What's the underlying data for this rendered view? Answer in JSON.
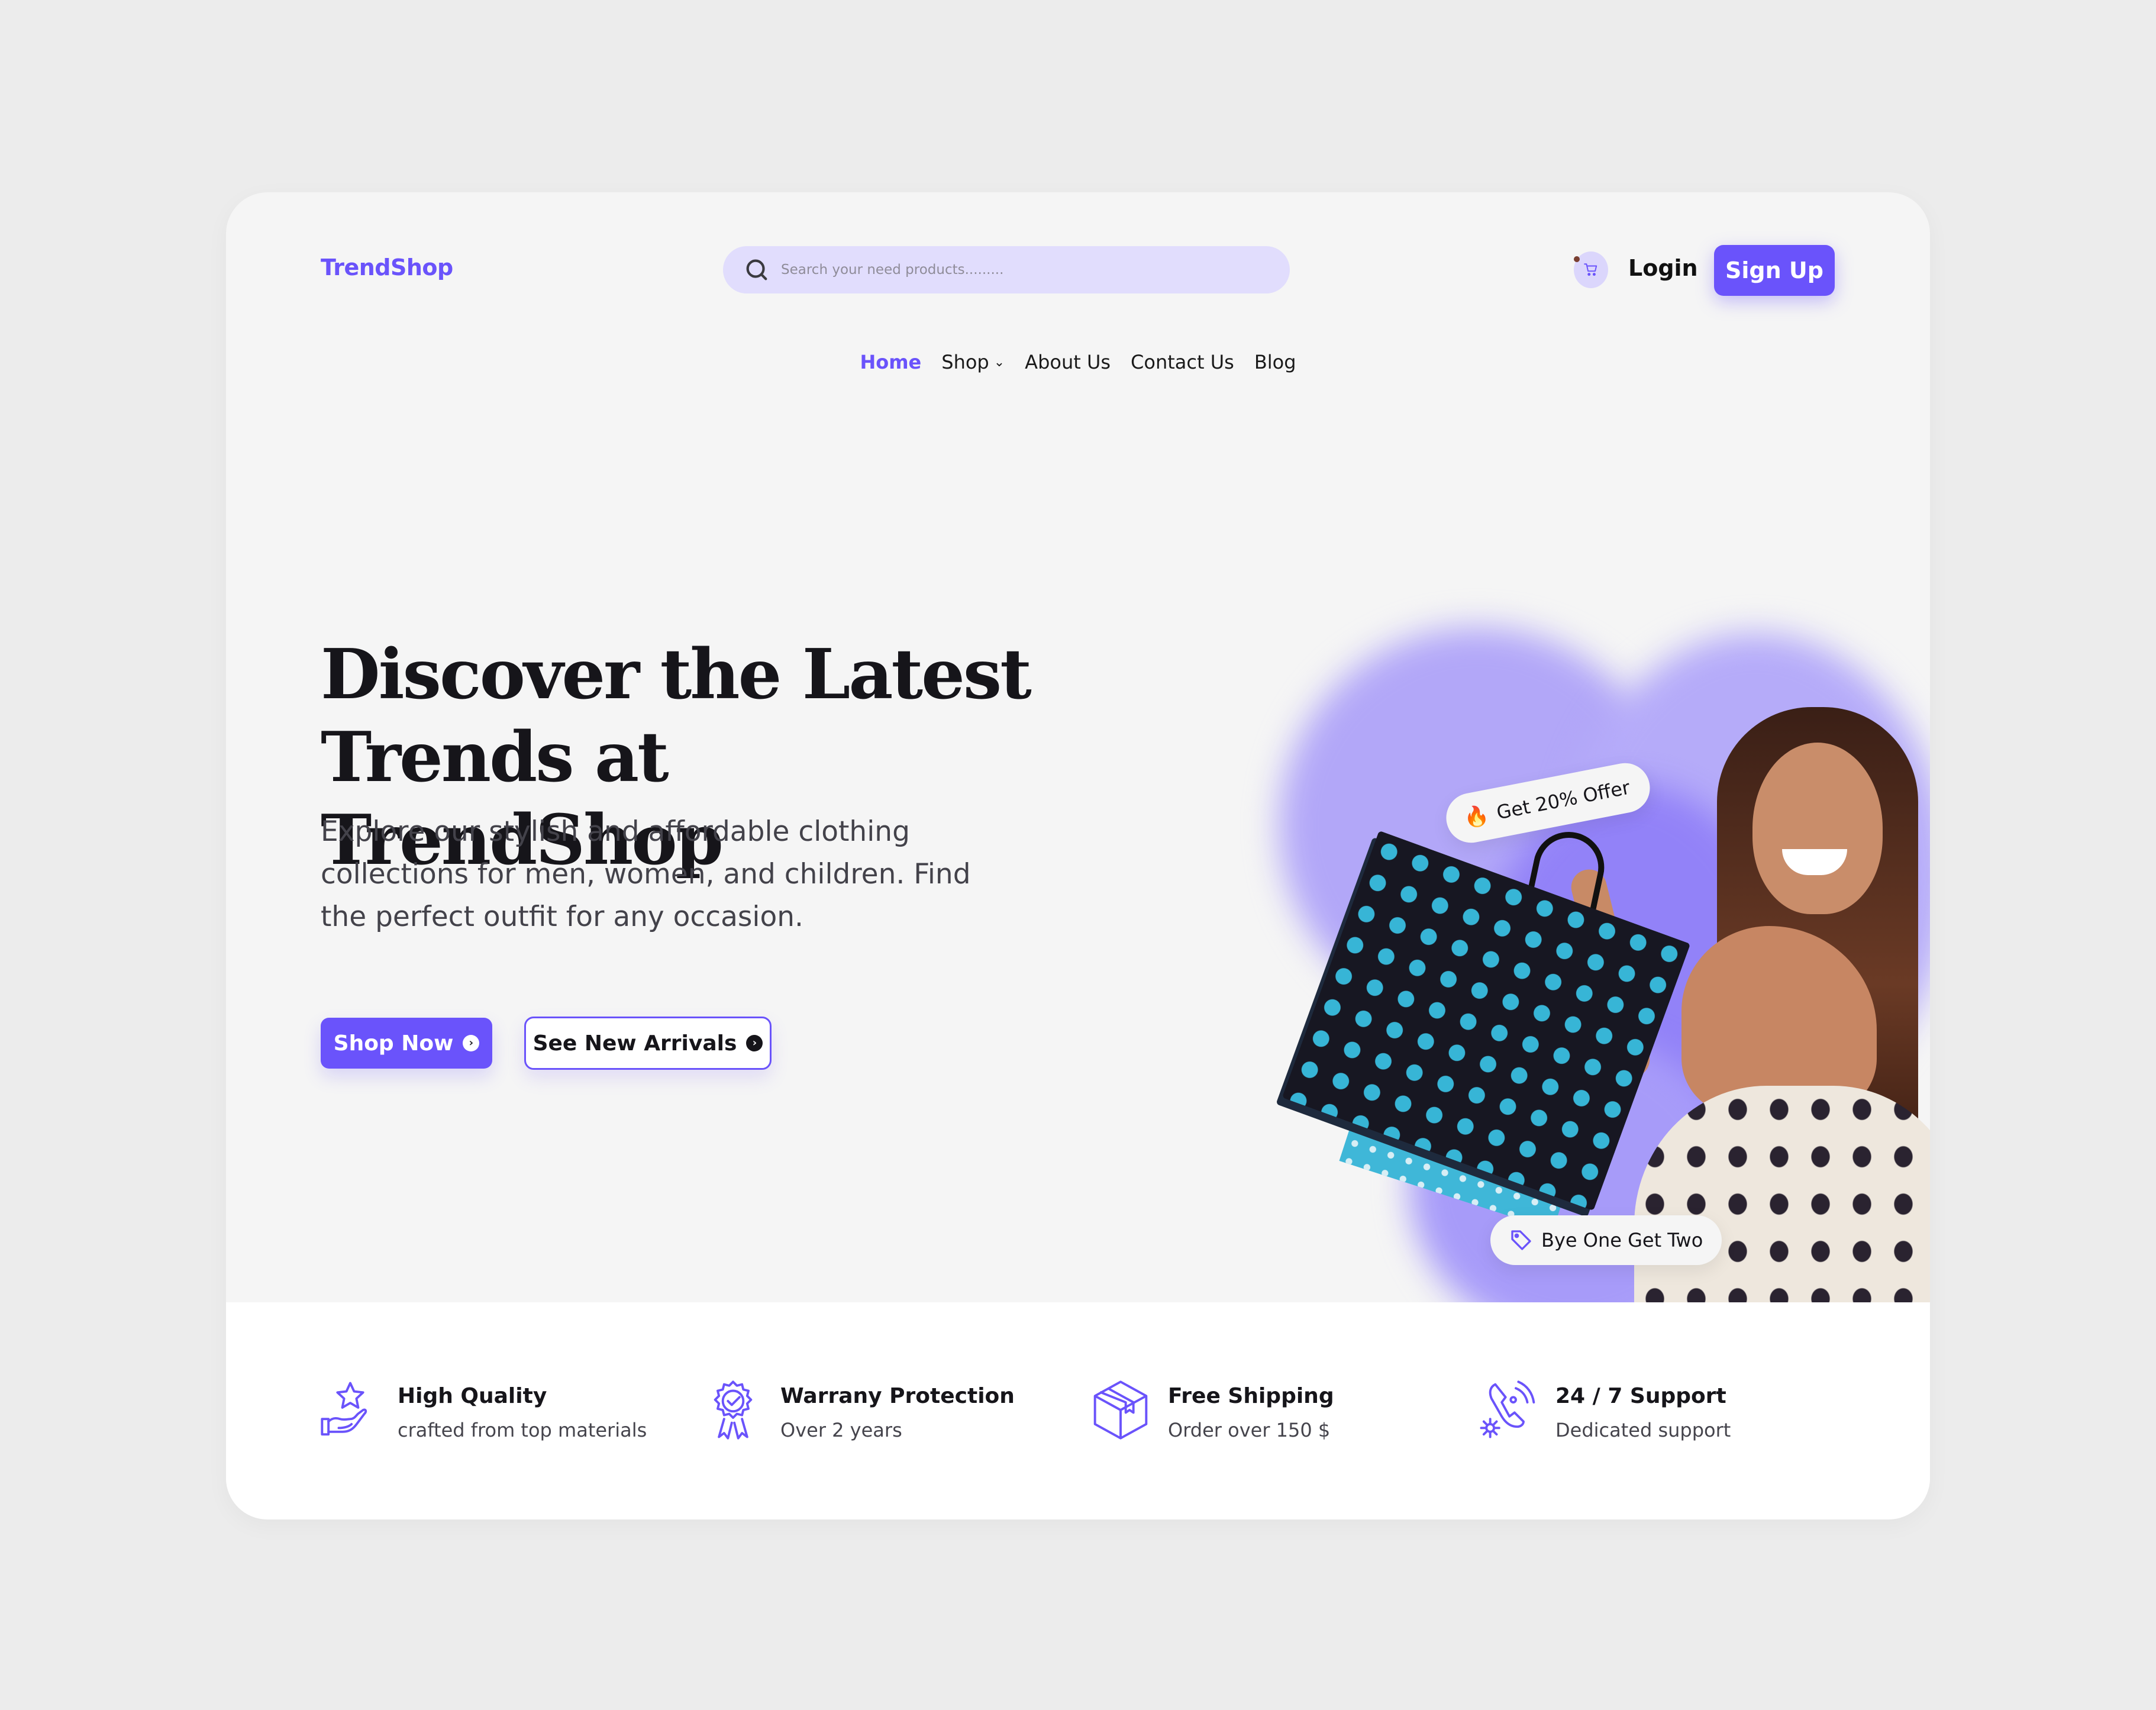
{
  "header": {
    "logo": "TrendShop",
    "search_placeholder": "Search your need products.........",
    "cart_icon": "cart-icon",
    "login_label": "Login",
    "signup_label": "Sign Up"
  },
  "nav": {
    "items": [
      {
        "label": "Home",
        "active": true
      },
      {
        "label": "Shop",
        "has_dropdown": true
      },
      {
        "label": "About Us"
      },
      {
        "label": "Contact Us"
      },
      {
        "label": "Blog"
      }
    ],
    "dropdown_glyph": "⌄"
  },
  "hero": {
    "title_line1": "Discover the Latest",
    "title_line2": "Trends at TrendShop",
    "description": "Explore our stylish and affordable clothing collections for men, women, and children. Find the perfect outfit for any occasion.",
    "primary_cta": "Shop Now",
    "secondary_cta": "See New Arrivals",
    "arrow_glyph": "›",
    "badge_offer": "Get 20% Offer",
    "badge_offer_icon": "🔥",
    "badge_bogo": "Bye One Get Two"
  },
  "features": [
    {
      "icon": "hand-star-icon",
      "title": "High Quality",
      "subtitle": "crafted from top materials"
    },
    {
      "icon": "award-ribbon-icon",
      "title": "Warrany Protection",
      "subtitle": "Over 2 years"
    },
    {
      "icon": "package-box-icon",
      "title": "Free Shipping",
      "subtitle": "Order over 150 $"
    },
    {
      "icon": "support-headset-icon",
      "title": "24 / 7 Support",
      "subtitle": "Dedicated support"
    }
  ],
  "colors": {
    "accent": "#6a53fb",
    "search_bg": "#e1ddfd",
    "page_bg": "#ececec",
    "card_bg": "#f5f5f5",
    "text_dark": "#16151a"
  }
}
